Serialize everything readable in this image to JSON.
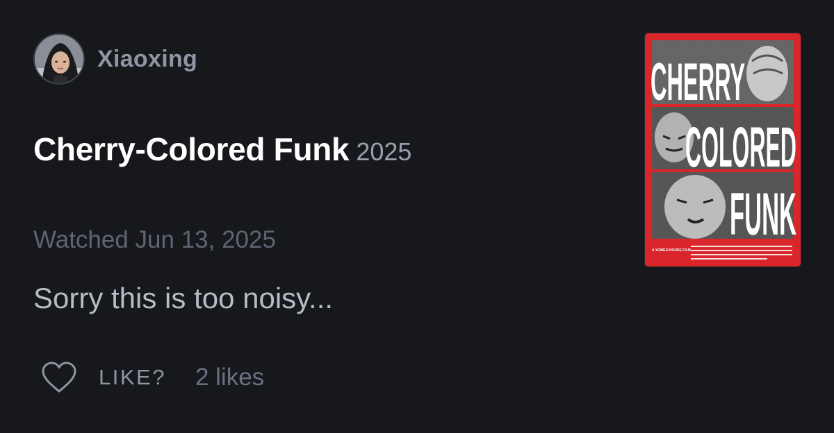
{
  "author": {
    "name": "Xiaoxing"
  },
  "film": {
    "title": "Cherry-Colored Funk",
    "year": "2025"
  },
  "entry": {
    "watched_label": "Watched Jun 13, 2025",
    "review": "Sorry this is too noisy..."
  },
  "actions": {
    "like_label": "LIKE?",
    "likes_count": "2 likes"
  },
  "poster": {
    "line1": "CHERRY",
    "line2": "COLORED",
    "line3": "FUNK",
    "credit": "A YOMEJI HOUSE FILM"
  },
  "colors": {
    "background": "#16181c",
    "poster_red": "#d8262b",
    "title_white": "#ffffff",
    "muted_text": "#8e96a3"
  }
}
